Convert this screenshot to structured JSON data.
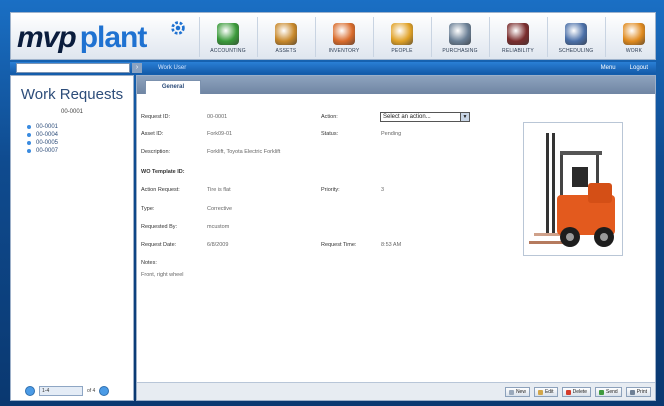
{
  "app": {
    "logo_part1": "mvp",
    "logo_part2": "plant"
  },
  "modules": [
    {
      "label": "Accounting",
      "icon": "money-icon",
      "color": "#3a9a3a"
    },
    {
      "label": "Assets",
      "icon": "building-icon",
      "color": "#c8882a"
    },
    {
      "label": "Inventory",
      "icon": "box-icon",
      "color": "#d96b2b"
    },
    {
      "label": "People",
      "icon": "people-icon",
      "color": "#e0a126"
    },
    {
      "label": "Purchasing",
      "icon": "scale-icon",
      "color": "#6a7f95"
    },
    {
      "label": "Reliability",
      "icon": "door-icon",
      "color": "#7a2d2d"
    },
    {
      "label": "Scheduling",
      "icon": "calendar-icon",
      "color": "#4a6fa8"
    },
    {
      "label": "Work",
      "icon": "gears-icon",
      "color": "#e08a1e"
    }
  ],
  "navbar": {
    "work_user": "Work User",
    "menu": "Menu",
    "logout": "Logout"
  },
  "sidebar": {
    "title": "Work Requests",
    "subtitle": "00-0001",
    "items": [
      "00-0001",
      "00-0004",
      "00-0005",
      "00-0007"
    ],
    "pager_select": "1-4",
    "pager_of": "of 4"
  },
  "tabs": [
    {
      "label": "General"
    }
  ],
  "form": {
    "request_id_label": "Request ID:",
    "request_id": "00-0001",
    "asset_id_label": "Asset ID:",
    "asset_id": "Fork09-01",
    "description_label": "Description:",
    "description": "Forklift, Toyota Electric Forklift",
    "wo_template_label": "WO Template ID:",
    "action_request_label": "Action Request:",
    "action_request": "Tire is flat",
    "type_label": "Type:",
    "type": "Corrective",
    "requested_by_label": "Requested By:",
    "requested_by": "mcustom",
    "request_date_label": "Request Date:",
    "request_date": "6/8/2009",
    "notes_label": "Notes:",
    "notes": "Front, right wheel",
    "action_label": "Action:",
    "action_value": "Select an action...",
    "status_label": "Status:",
    "status": "Pending",
    "priority_label": "Priority:",
    "priority": "3",
    "request_time_label": "Request Time:",
    "request_time": "8:53 AM"
  },
  "footer_buttons": [
    {
      "label": "New",
      "icon": "new-icon",
      "color": "#9aa9bb"
    },
    {
      "label": "Edit",
      "icon": "edit-icon",
      "color": "#d2a64a"
    },
    {
      "label": "Delete",
      "icon": "delete-icon",
      "color": "#d43a2a"
    },
    {
      "label": "Send",
      "icon": "send-icon",
      "color": "#3e9a3e"
    },
    {
      "label": "Print",
      "icon": "print-icon",
      "color": "#6d7f95"
    }
  ]
}
